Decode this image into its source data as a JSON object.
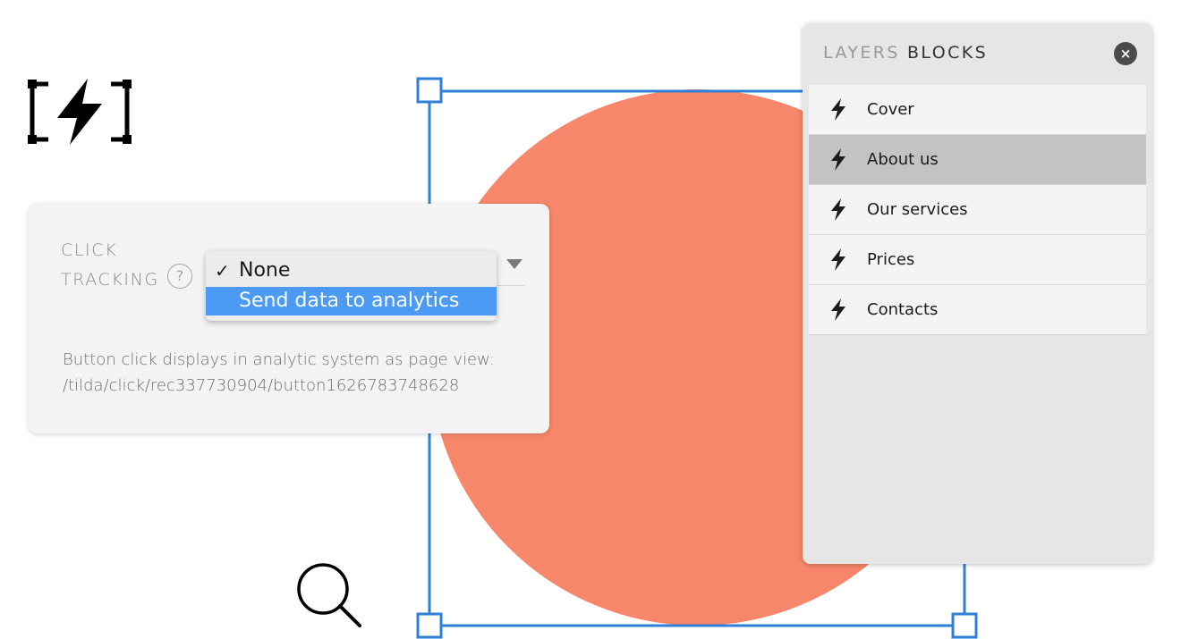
{
  "click_tracking": {
    "label_line1": "CLICK",
    "label_line2": "TRACKING",
    "help": "?",
    "options": [
      {
        "check": "✓",
        "label": "None",
        "selected": true
      },
      {
        "label": "Send data to analytics",
        "highlighted": true
      }
    ],
    "description_line1": "Button click displays in analytic system as page view:",
    "description_line2": "/tilda/click/rec337730904/button1626783748628"
  },
  "blocks_panel": {
    "tab_layers": "LAYERS",
    "tab_blocks": "BLOCKS",
    "close_symbol": "×",
    "items": [
      {
        "label": "Cover",
        "active": false
      },
      {
        "label": "About us",
        "active": true
      },
      {
        "label": "Our services",
        "active": false
      },
      {
        "label": "Prices",
        "active": false
      },
      {
        "label": "Contacts",
        "active": false
      }
    ]
  },
  "colors": {
    "circle": "#f6876a",
    "selection": "#2f7fd8",
    "highlight": "#4b9af5",
    "active_item": "#c3c3c3"
  },
  "icons": {
    "logo": "zero-block-lightning-icon",
    "search": "magnifier-icon",
    "block": "lightning-icon",
    "close": "close-icon",
    "help": "help-icon",
    "dropdown": "chevron-down-icon"
  }
}
